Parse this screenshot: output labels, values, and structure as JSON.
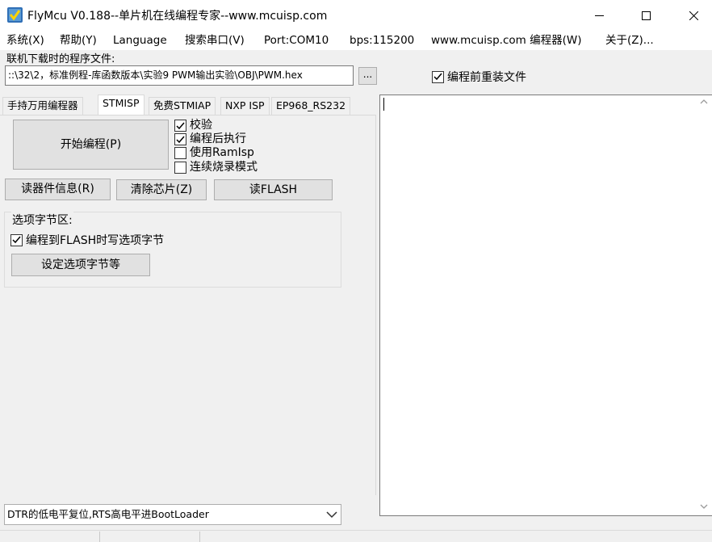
{
  "window": {
    "title": "FlyMcu V0.188--单片机在线编程专家--www.mcuisp.com"
  },
  "menu": [
    "系统(X)",
    "帮助(Y)",
    "Language",
    "搜索串口(V)",
    "Port:COM10",
    "bps:115200",
    "www.mcuisp.com 编程器(W)",
    "关于(Z)..."
  ],
  "file": {
    "label": "联机下载时的程序文件:",
    "path": "::\\32\\2，标准例程-库函数版本\\实验9 PWM输出实验\\OBJ\\PWM.hex",
    "browse_label": "...",
    "reload_label": "编程前重装文件",
    "reload_checked": true
  },
  "tabs": [
    "手持万用编程器",
    "STMISP",
    "免费STMIAP",
    "NXP ISP",
    "EP968_RS232"
  ],
  "active_tab": "STMISP",
  "stmisp": {
    "start_label": "开始编程(P)",
    "options": [
      {
        "label": "校验",
        "checked": true
      },
      {
        "label": "编程后执行",
        "checked": true
      },
      {
        "label": "使用RamIsp",
        "checked": false
      },
      {
        "label": "连续烧录模式",
        "checked": false
      }
    ],
    "read_info_label": "读器件信息(R)",
    "erase_label": "清除芯片(Z)",
    "read_flash_label": "读FLASH",
    "option_group_title": "选项字节区:",
    "option_flash_label": "编程到FLASH时写选项字节",
    "option_flash_checked": true,
    "set_option_label": "设定选项字节等"
  },
  "reset_mode": {
    "value": "DTR的低电平复位,RTS高电平进BootLoader"
  },
  "log": {
    "text": ""
  },
  "colors": {
    "window_bg": "#f0f0f0",
    "button_bg": "#e1e1e1",
    "log_border": "#7a7a7a"
  }
}
